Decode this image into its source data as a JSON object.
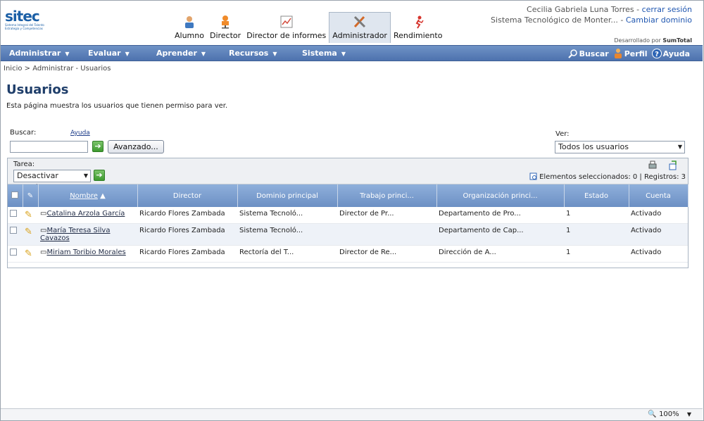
{
  "logo": {
    "word": "sitec",
    "tagline": "Sistema Integral del Talento Estrategia y Competencias"
  },
  "roles": [
    {
      "label": "Alumno",
      "icon": "student-icon",
      "active": false
    },
    {
      "label": "Director",
      "icon": "director-chair-icon",
      "active": false
    },
    {
      "label": "Director de informes",
      "icon": "report-chart-icon",
      "active": false
    },
    {
      "label": "Administrador",
      "icon": "admin-tools-icon",
      "active": true
    },
    {
      "label": "Rendimiento",
      "icon": "runner-icon",
      "active": false
    }
  ],
  "user": {
    "name": "Cecilia Gabriela Luna Torres",
    "logout": "cerrar sesión",
    "domain": "Sistema Tecnológico de Monter...",
    "change_domain": "Cambiar dominio"
  },
  "dev": {
    "prefix": "Desarrollado por",
    "brand": "SumTotal"
  },
  "nav": {
    "menus": [
      "Administrar",
      "Evaluar",
      "Aprender",
      "Recursos",
      "Sistema"
    ],
    "search": "Buscar",
    "profile": "Perfil",
    "help": "Ayuda"
  },
  "breadcrumb": "Inicio > Administrar - Usuarios",
  "page": {
    "title": "Usuarios",
    "description": "Esta página muestra los usuarios que tienen permiso para ver."
  },
  "search": {
    "label": "Buscar:",
    "help": "Ayuda",
    "value": "",
    "advanced": "Avanzado..."
  },
  "view": {
    "label": "Ver:",
    "value": "Todos los usuarios"
  },
  "task": {
    "label": "Tarea:",
    "value": "Desactivar cuentas"
  },
  "records": {
    "text": "Elementos seleccionados: 0 | Registros: 3"
  },
  "table": {
    "headers": [
      "Nombre",
      "Director",
      "Dominio principal",
      "Trabajo princi...",
      "Organización princi...",
      "Estado",
      "Cuenta"
    ],
    "rows": [
      {
        "name": "Catalina Arzola García",
        "director": "Ricardo Flores Zambada",
        "domain": "Sistema Tecnoló...",
        "job": "Director de Pr...",
        "org": "Departamento de Pro...",
        "state": "1",
        "account": "Activado"
      },
      {
        "name": "María Teresa Silva Cavazos",
        "director": "Ricardo Flores Zambada",
        "domain": "Sistema Tecnoló...",
        "job": "",
        "org": "Departamento de Cap...",
        "state": "1",
        "account": "Activado"
      },
      {
        "name": "Miriam Toribio Morales",
        "director": "Ricardo Flores Zambada",
        "domain": "Rectoría del T...",
        "job": "Director de Re...",
        "org": "Dirección de A...",
        "state": "1",
        "account": "Activado"
      }
    ]
  },
  "status": {
    "zoom": "100%"
  },
  "colors": {
    "nav": "#5a7fb9",
    "header_row": "#7c9ed0",
    "title": "#1f3e6a"
  }
}
